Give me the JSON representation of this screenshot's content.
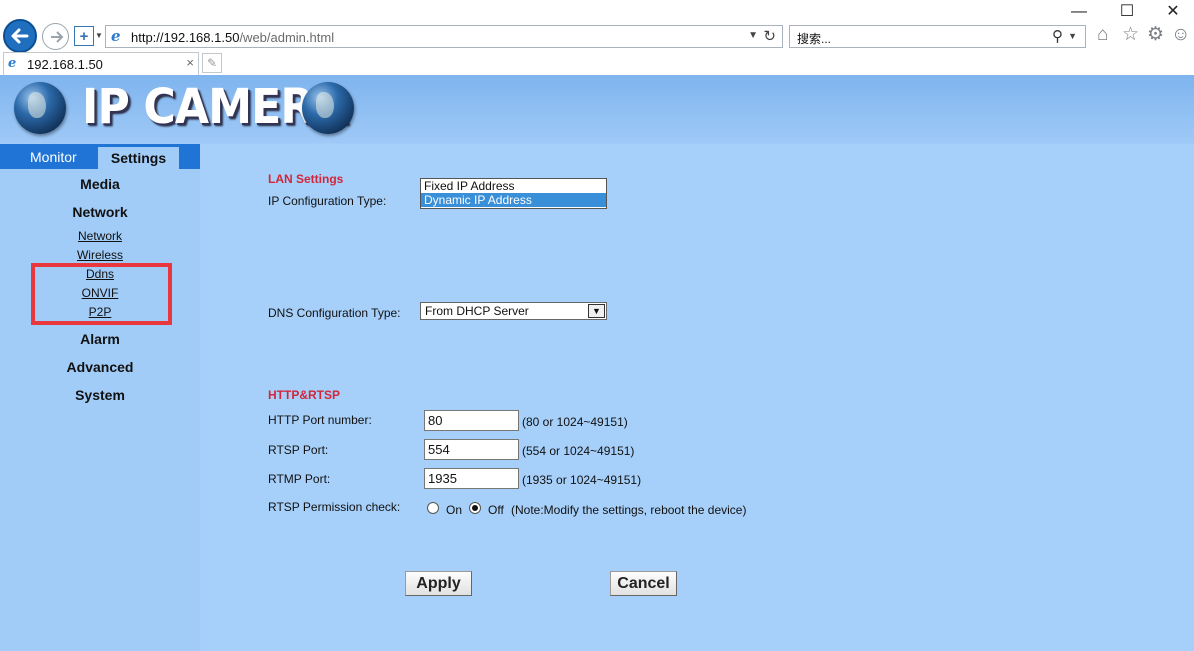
{
  "browser": {
    "url_host": "http://192.168.1.50",
    "url_path": "/web/admin.html",
    "search_placeholder": "搜索...",
    "tab_title": "192.168.1.50",
    "tab_close": "×"
  },
  "banner": {
    "title": "IP CAMERA"
  },
  "topnav": {
    "monitor": "Monitor",
    "settings": "Settings"
  },
  "sidebar": {
    "media": "Media",
    "network": "Network",
    "links": [
      "Network",
      "Wireless",
      "Ddns",
      "ONVIF",
      "P2P"
    ],
    "alarm": "Alarm",
    "advanced": "Advanced",
    "system": "System"
  },
  "lan": {
    "title": "LAN Settings",
    "ip_type_label": "IP Configuration Type:",
    "ip_options": [
      "Fixed IP Address",
      "Dynamic IP Address"
    ],
    "ip_selected": "Dynamic IP Address",
    "dns_label": "DNS Configuration Type:",
    "dns_value": "From DHCP Server"
  },
  "http": {
    "title": "HTTP&RTSP",
    "http_port_label": "HTTP Port number:",
    "http_port_value": "80",
    "http_port_hint": "(80 or 1024~49151)",
    "rtsp_port_label": "RTSP Port:",
    "rtsp_port_value": "554",
    "rtsp_port_hint": "(554 or 1024~49151)",
    "rtmp_port_label": "RTMP Port:",
    "rtmp_port_value": "1935",
    "rtmp_port_hint": "(1935 or 1024~49151)",
    "perm_label": "RTSP Permission check:",
    "perm_on": "On",
    "perm_off": "Off",
    "perm_selected": "Off",
    "perm_note": "(Note:Modify the settings, reboot the device)"
  },
  "actions": {
    "apply": "Apply",
    "cancel": "Cancel"
  }
}
